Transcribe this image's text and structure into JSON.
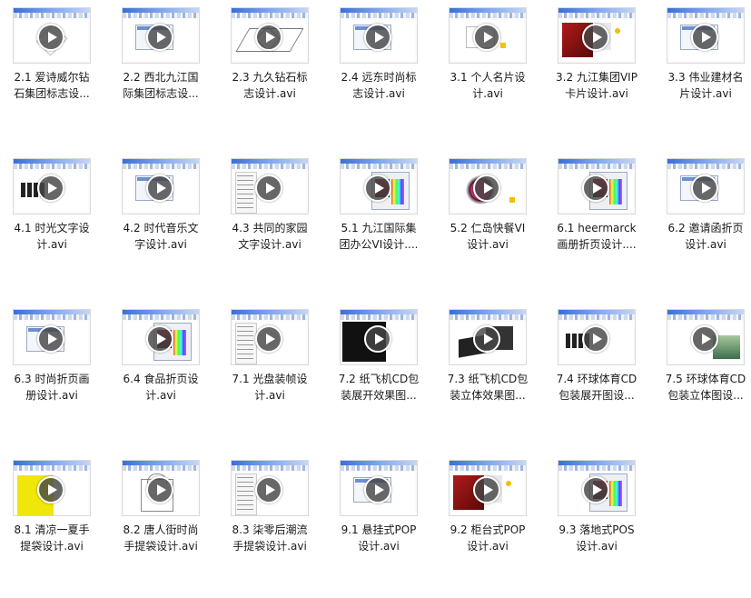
{
  "files": [
    {
      "name": "2.1 爱诗威尔钻石集团标志设...",
      "line1": "2.1 爱诗威尔钻",
      "line2": "石集团标志设...",
      "thumb": "logo"
    },
    {
      "name": "2.2 西北九江国际集团标志设...",
      "line1": "2.2 西北九江国",
      "line2": "际集团标志设...",
      "thumb": "window"
    },
    {
      "name": "2.3 九久钻石标志设计.avi",
      "line1": "2.3 九久钻石标",
      "line2": "志设计.avi",
      "thumb": "diamond"
    },
    {
      "name": "2.4 远东时尚标志设计.avi",
      "line1": "2.4 远东时尚标",
      "line2": "志设计.avi",
      "thumb": "window"
    },
    {
      "name": "3.1 个人名片设计.avi",
      "line1": "3.1 个人名片设",
      "line2": "计.avi",
      "thumb": "card"
    },
    {
      "name": "3.2 九江集团VIP卡片设计.avi",
      "line1": "3.2 九江集团VIP",
      "line2": "卡片设计.avi",
      "thumb": "red"
    },
    {
      "name": "3.3 伟业建材名片设计.avi",
      "line1": "3.3 伟业建材名",
      "line2": "片设计.avi",
      "thumb": "window"
    },
    {
      "name": "4.1 时光文字设计.avi",
      "line1": "4.1 时光文字设",
      "line2": "计.avi",
      "thumb": "text"
    },
    {
      "name": "4.2 时代音乐文字设计.avi",
      "line1": "4.2 时代音乐文",
      "line2": "字设计.avi",
      "thumb": "window"
    },
    {
      "name": "4.3 共同的家园文字设计.avi",
      "line1": "4.3 共同的家园",
      "line2": "文字设计.avi",
      "thumb": "menu"
    },
    {
      "name": "5.1 九江国际集团办公VI设计....",
      "line1": "5.1 九江国际集",
      "line2": "团办公VI设计....",
      "thumb": "dialog"
    },
    {
      "name": "5.2 仁岛快餐VI设计.avi",
      "line1": "5.2 仁岛快餐VI",
      "line2": "设计.avi",
      "thumb": "magenta"
    },
    {
      "name": "6.1 heermarck画册折页设计....",
      "line1": "6.1 heermarck",
      "line2": "画册折页设计....",
      "thumb": "dialog"
    },
    {
      "name": "6.2 邀请函折页设计.avi",
      "line1": "6.2 邀请函折页",
      "line2": "设计.avi",
      "thumb": "window"
    },
    {
      "name": "6.3 时尚折页画册设计.avi",
      "line1": "6.3 时尚折页画",
      "line2": "册设计.avi",
      "thumb": "window"
    },
    {
      "name": "6.4 食品折页设计.avi",
      "line1": "6.4 食品折页设",
      "line2": "计.avi",
      "thumb": "dialog"
    },
    {
      "name": "7.1 光盘装帧设计.avi",
      "line1": "7.1 光盘装帧设",
      "line2": "计.avi",
      "thumb": "menu"
    },
    {
      "name": "7.2 纸飞机CD包装展开效果图...",
      "line1": "7.2 纸飞机CD包",
      "line2": "装展开效果图...",
      "thumb": "black"
    },
    {
      "name": "7.3 纸飞机CD包装立体效果图...",
      "line1": "7.3 纸飞机CD包",
      "line2": "装立体效果图...",
      "thumb": "dark"
    },
    {
      "name": "7.4 环球体育CD包装展开图设...",
      "line1": "7.4 环球体育CD",
      "line2": "包装展开图设...",
      "thumb": "text"
    },
    {
      "name": "7.5 环球体育CD包装立体图设...",
      "line1": "7.5 环球体育CD",
      "line2": "包装立体图设...",
      "thumb": "photo"
    },
    {
      "name": "8.1 清凉一夏手提袋设计.avi",
      "line1": "8.1 清凉一夏手",
      "line2": "提袋设计.avi",
      "thumb": "yellow"
    },
    {
      "name": "8.2 唐人街时尚手提袋设计.avi",
      "line1": "8.2 唐人街时尚",
      "line2": "手提袋设计.avi",
      "thumb": "bag"
    },
    {
      "name": "8.3 柒零后潮流手提袋设计.avi",
      "line1": "8.3 柒零后潮流",
      "line2": "手提袋设计.avi",
      "thumb": "menu"
    },
    {
      "name": "9.1 悬挂式POP设计.avi",
      "line1": "9.1 悬挂式POP",
      "line2": "设计.avi",
      "thumb": "window"
    },
    {
      "name": "9.2 柜台式POP设计.avi",
      "line1": "9.2 柜台式POP",
      "line2": "设计.avi",
      "thumb": "red"
    },
    {
      "name": "9.3 落地式POS设计.avi",
      "line1": "9.3 落地式POS",
      "line2": "设计.avi",
      "thumb": "dialog"
    }
  ],
  "icons": {
    "play": "play-icon"
  },
  "colors": {
    "play_overlay": "#464646",
    "label_text": "#1a1a1a",
    "titlebar": "#3a6fd8"
  }
}
